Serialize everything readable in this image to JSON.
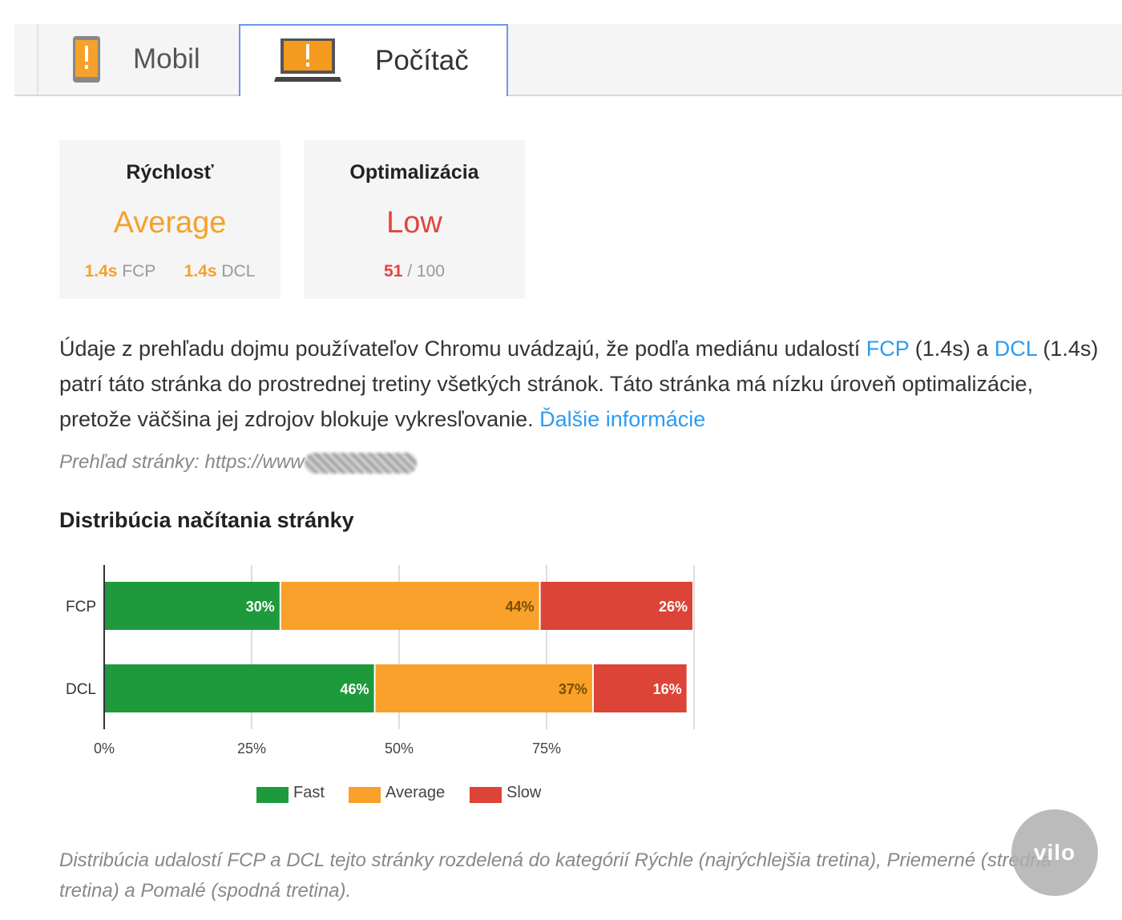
{
  "tabs": [
    {
      "label": "Mobil",
      "icon": "mobile-phone-warning-icon",
      "active": false
    },
    {
      "label": "Počítač",
      "icon": "laptop-warning-icon",
      "active": true
    }
  ],
  "colors": {
    "orange": "#f5a12b",
    "red": "#e2453f",
    "green": "#1e9a3c",
    "link": "#2d9bf0"
  },
  "cards": {
    "speed": {
      "title": "Rýchlosť",
      "rating": "Average",
      "fcp_value": "1.4s",
      "fcp_label": "FCP",
      "dcl_value": "1.4s",
      "dcl_label": "DCL"
    },
    "optimization": {
      "title": "Optimalizácia",
      "rating": "Low",
      "score": "51",
      "score_max": "/ 100"
    }
  },
  "description": {
    "part1": "Údaje z prehľadu dojmu používateľov Chromu uvádzajú, že podľa mediánu udalostí ",
    "fcp_link": "FCP",
    "part2": " (1.4s) a ",
    "dcl_link": "DCL",
    "part3": " (1.4s) patrí táto stránka do prostrednej tretiny všetkých stránok. Táto stránka má nízku úroveň optimalizácie, pretože väčšina jej zdrojov blokuje vykresľovanie. ",
    "more_link": "Ďalšie informácie"
  },
  "overview": {
    "label": "Prehľad stránky: https://www"
  },
  "section_title": "Distribúcia načítania stránky",
  "chart_data": {
    "type": "bar",
    "stacked": true,
    "orientation": "horizontal",
    "categories": [
      "FCP",
      "DCL"
    ],
    "series": [
      {
        "name": "Fast",
        "color": "#1e9a3c",
        "values": [
          30,
          46
        ]
      },
      {
        "name": "Average",
        "color": "#f9a12a",
        "values": [
          44,
          37
        ]
      },
      {
        "name": "Slow",
        "color": "#dc4437",
        "values": [
          26,
          16
        ]
      }
    ],
    "x_ticks": [
      "0%",
      "25%",
      "50%",
      "75%"
    ],
    "xlim": [
      0,
      100
    ],
    "legend_position": "bottom"
  },
  "footnote": "Distribúcia udalostí FCP a DCL tejto stránky rozdelená do kategórií Rýchle (najrýchlejšia tretina), Priemerné (stredná tretina) a Pomalé (spodná tretina).",
  "watermark": "vilo"
}
